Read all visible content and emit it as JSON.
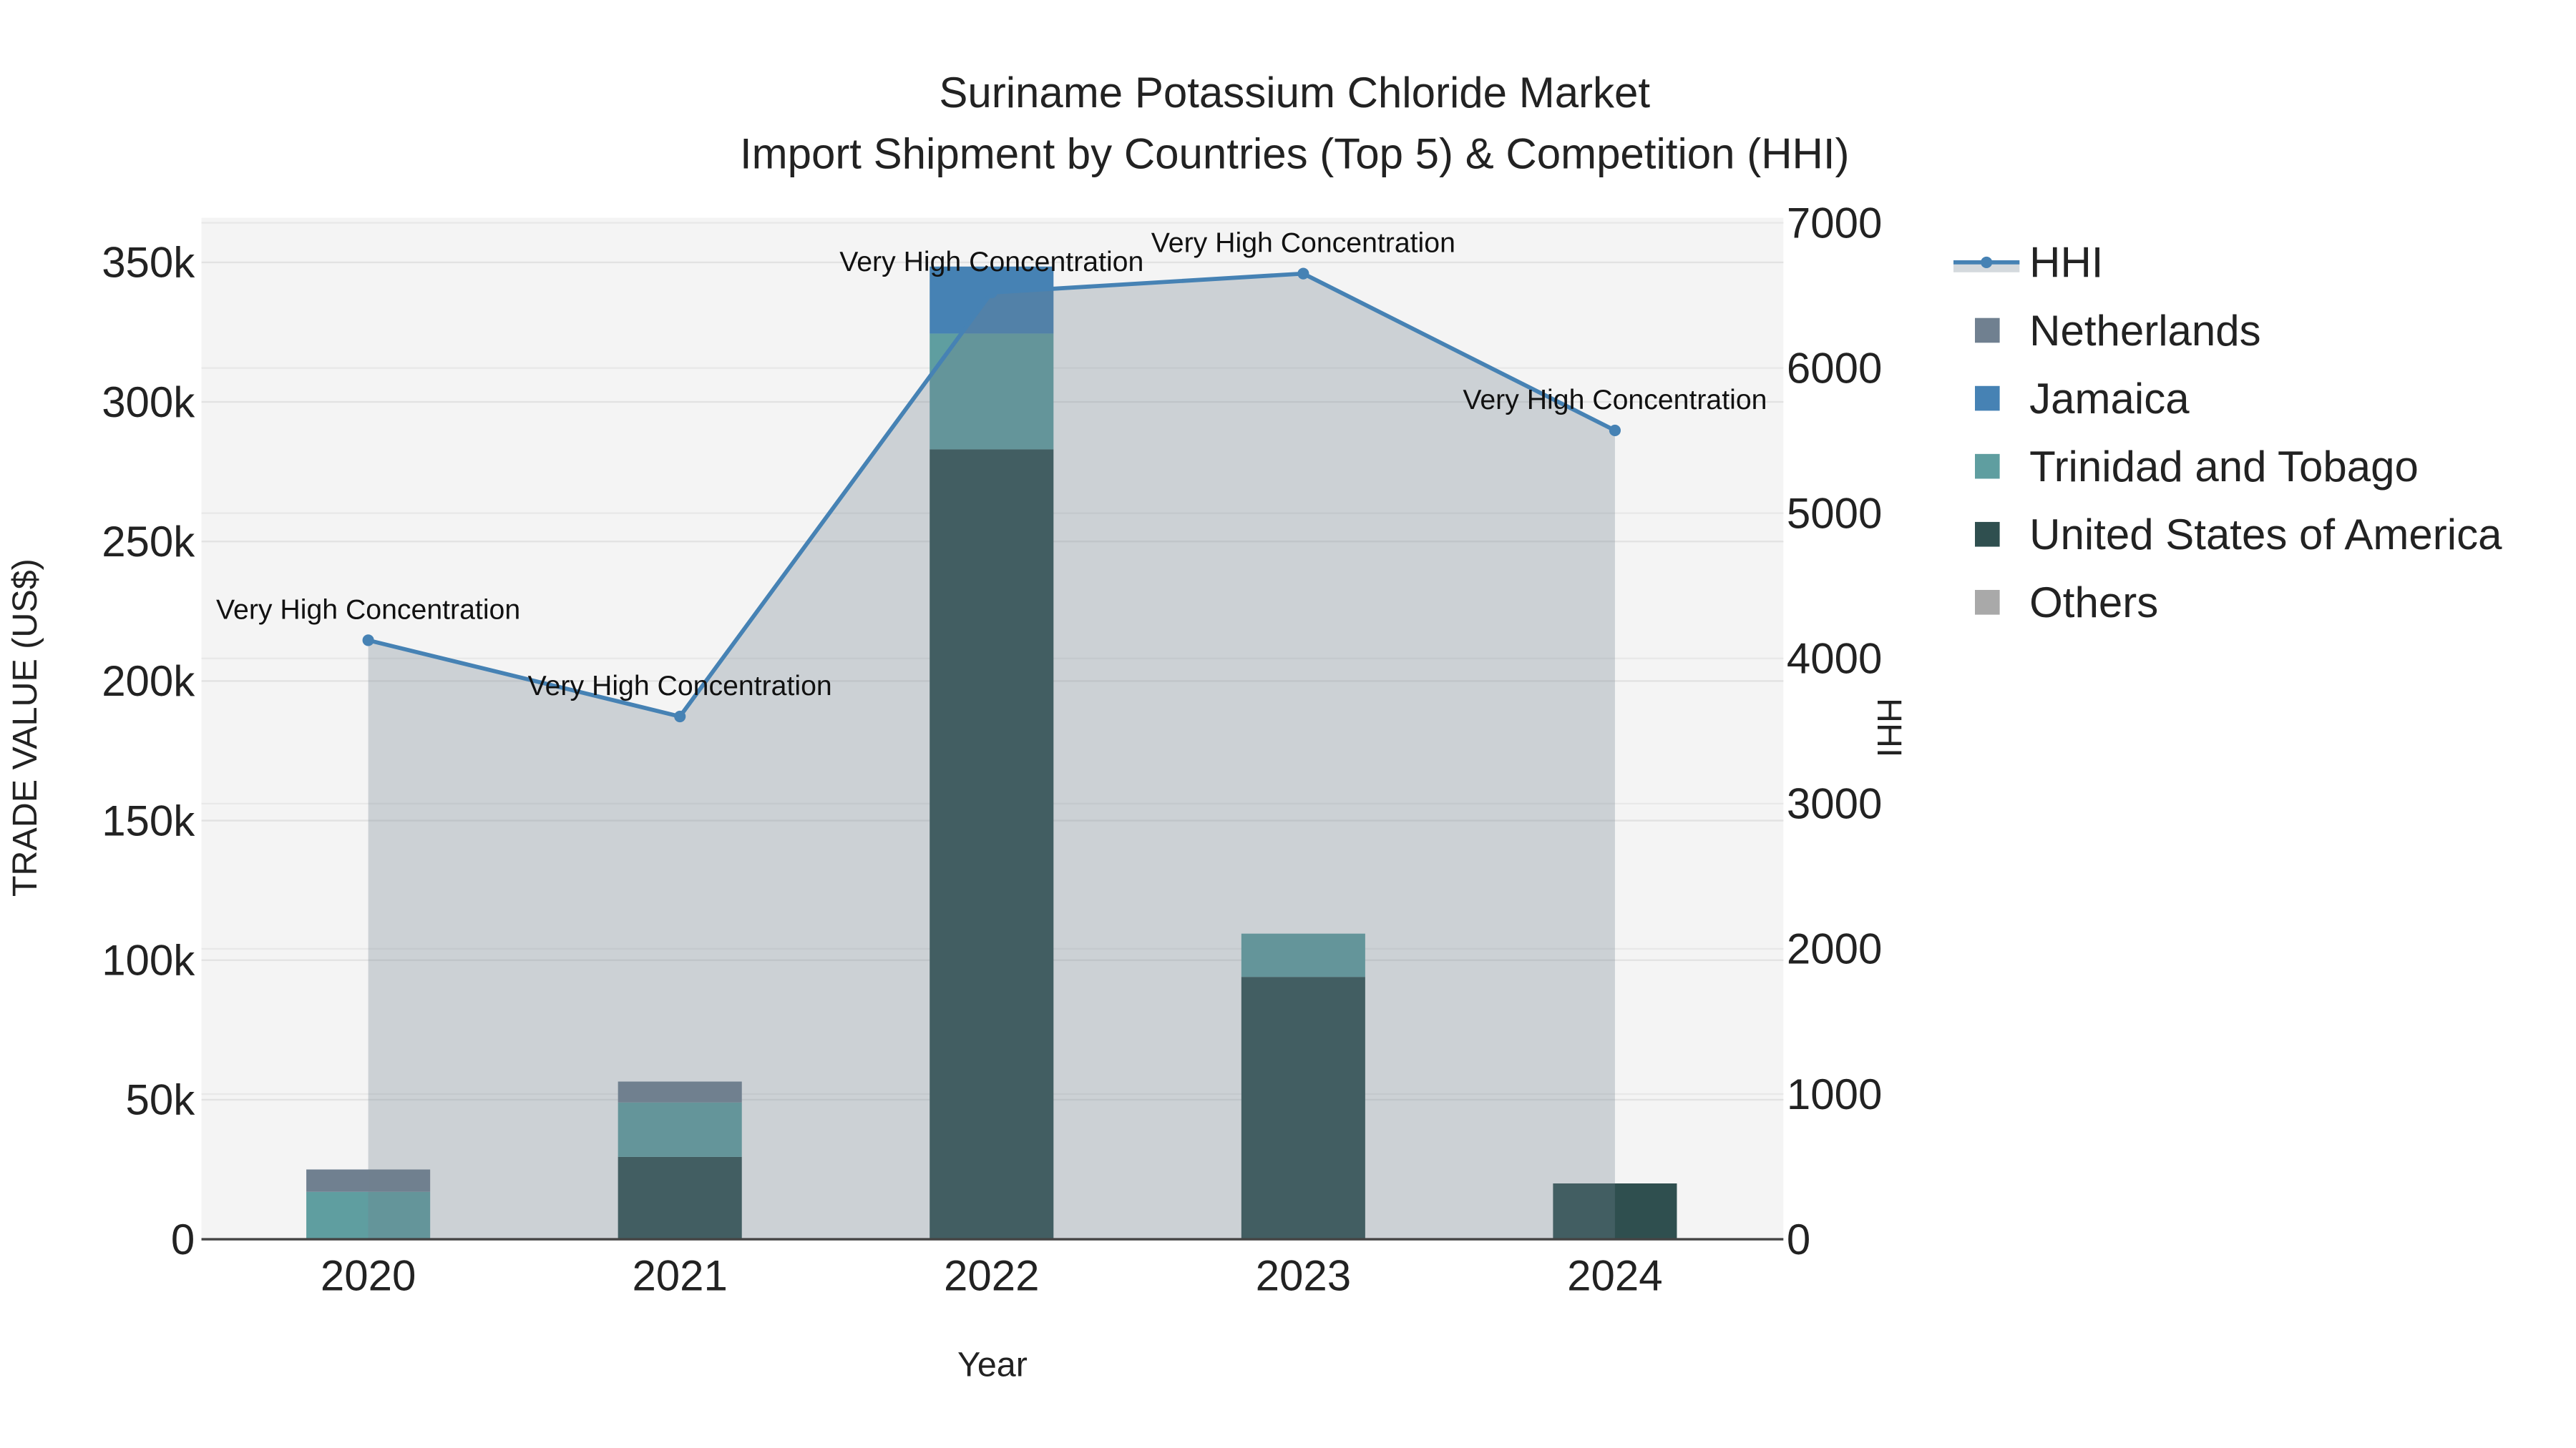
{
  "chart_data": {
    "type": "bar",
    "title": "Suriname Potassium Chloride Market",
    "subtitle": "Import Shipment by Countries (Top 5) & Competition (HHI)",
    "xlabel": "Year",
    "ylabel": "TRADE VALUE (US$)",
    "y2label": "HHI",
    "categories": [
      "2020",
      "2021",
      "2022",
      "2023",
      "2024"
    ],
    "ylim": [
      0,
      365000
    ],
    "y_ticks": [
      0,
      50000,
      100000,
      150000,
      200000,
      250000,
      300000,
      350000
    ],
    "y_tick_labels": [
      "0",
      "50k",
      "100k",
      "150k",
      "200k",
      "250k",
      "300k",
      "350k"
    ],
    "y2lim": [
      0,
      7000
    ],
    "y2_ticks": [
      0,
      1000,
      2000,
      3000,
      4000,
      5000,
      6000,
      7000
    ],
    "y2_tick_labels": [
      "0",
      "1000",
      "2000",
      "3000",
      "4000",
      "5000",
      "6000",
      "7000"
    ],
    "stacked": true,
    "series": [
      {
        "name": "United States of America",
        "color": "#2f4f4f",
        "values": [
          0,
          29500,
          283000,
          94000,
          20000
        ]
      },
      {
        "name": "Trinidad and Tobago",
        "color": "#5f9ea0",
        "values": [
          17000,
          19500,
          41500,
          15500,
          0
        ]
      },
      {
        "name": "Jamaica",
        "color": "#4682b4",
        "values": [
          0,
          0,
          24000,
          0,
          0
        ]
      },
      {
        "name": "Netherlands",
        "color": "#708090",
        "values": [
          8000,
          7500,
          0,
          0,
          0
        ]
      },
      {
        "name": "Others",
        "color": "#a9a9a9",
        "values": [
          0,
          0,
          0,
          0,
          0
        ]
      }
    ],
    "line_series": {
      "name": "HHI",
      "color": "#4682b4",
      "fill": "rgba(112,128,144,0.3)",
      "values": [
        4125,
        3600,
        6520,
        6650,
        5570
      ]
    },
    "annotations": [
      "Very High Concentration",
      "Very High Concentration",
      "Very High Concentration",
      "Very High Concentration",
      "Very High Concentration"
    ],
    "legend": {
      "placement": "right",
      "items": [
        "HHI",
        "Netherlands",
        "Jamaica",
        "Trinidad and Tobago",
        "United States of America",
        "Others"
      ]
    },
    "grid": true
  }
}
